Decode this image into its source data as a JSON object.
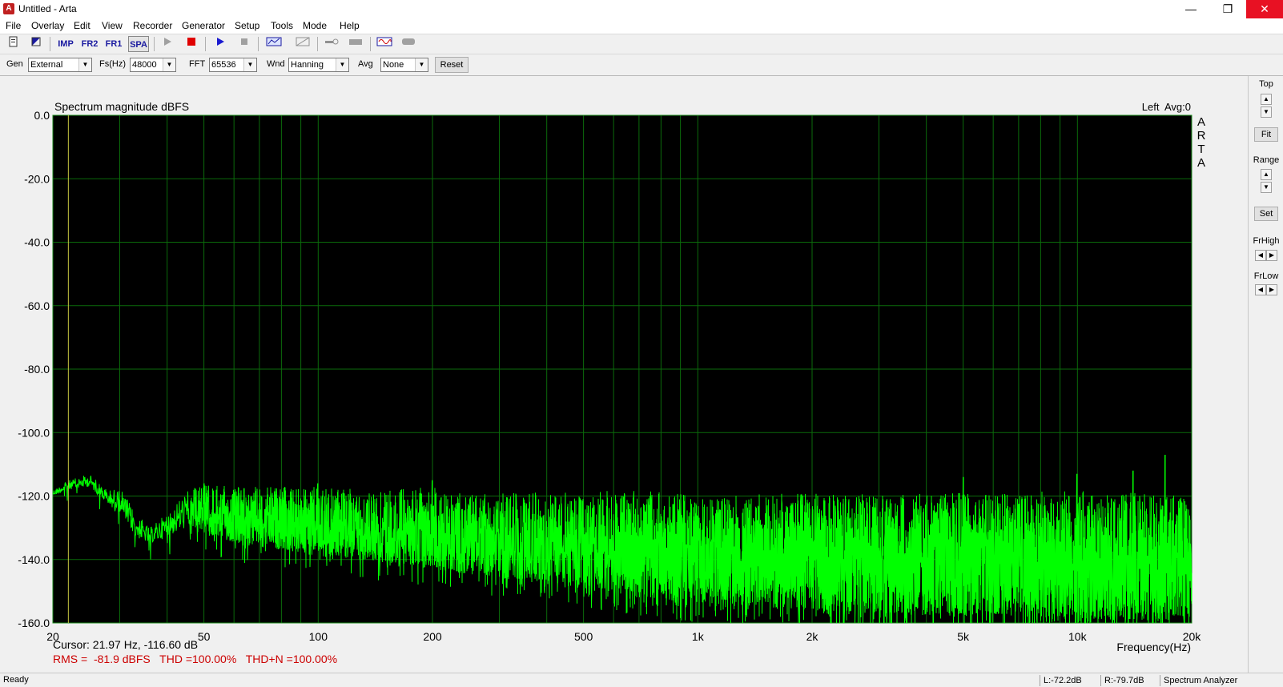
{
  "window": {
    "title": "Untitled - Arta",
    "minimize": "—",
    "maximize": "❐",
    "close": "✕"
  },
  "menu": [
    "File",
    "Overlay",
    "Edit",
    "View",
    "Recorder",
    "Generator",
    "Setup",
    "Tools",
    "Mode",
    "Help"
  ],
  "toolbar": {
    "imp": "IMP",
    "fr2": "FR2",
    "fr1": "FR1",
    "spa": "SPA"
  },
  "controls": {
    "gen_label": "Gen",
    "gen_value": "External",
    "fs_label": "Fs(Hz)",
    "fs_value": "48000",
    "fft_label": "FFT",
    "fft_value": "65536",
    "wnd_label": "Wnd",
    "wnd_value": "Hanning",
    "avg_label": "Avg",
    "avg_value": "None",
    "reset_label": "Reset"
  },
  "chart_data": {
    "type": "line",
    "title": "Spectrum magnitude dBFS",
    "channel_info": "Left  Avg:0",
    "watermark": [
      "A",
      "R",
      "T",
      "A"
    ],
    "xlabel": "Frequency(Hz)",
    "x_scale": "log",
    "xlim": [
      20,
      20000
    ],
    "ylim": [
      -160,
      0
    ],
    "y_ticks": [
      0,
      -20,
      -40,
      -60,
      -80,
      -100,
      -120,
      -140,
      -160
    ],
    "y_tick_labels": [
      "0.0",
      "-20.0",
      "-40.0",
      "-60.0",
      "-80.0",
      "-100.0",
      "-120.0",
      "-140.0",
      "-160.0"
    ],
    "x_tick_labels": [
      {
        "v": 20,
        "t": "20"
      },
      {
        "v": 50,
        "t": "50"
      },
      {
        "v": 100,
        "t": "100"
      },
      {
        "v": 200,
        "t": "200"
      },
      {
        "v": 500,
        "t": "500"
      },
      {
        "v": 1000,
        "t": "1k"
      },
      {
        "v": 2000,
        "t": "2k"
      },
      {
        "v": 5000,
        "t": "5k"
      },
      {
        "v": 10000,
        "t": "10k"
      },
      {
        "v": 20000,
        "t": "20k"
      }
    ],
    "grid": true,
    "cursor_freq": 21.97,
    "series": [
      {
        "color": "#00ff00",
        "noise_floor": {
          "x": [
            20,
            22,
            25,
            28,
            30,
            33,
            36,
            40,
            45,
            50,
            60,
            80,
            100,
            150,
            200,
            300,
            500,
            700,
            1000,
            1500,
            2000,
            3000,
            5000,
            7000,
            10000,
            14000,
            17000,
            20000
          ],
          "upper": [
            -118,
            -115,
            -113,
            -118,
            -117,
            -125,
            -130,
            -125,
            -118,
            -116,
            -117,
            -117,
            -117,
            -118,
            -117,
            -119,
            -118,
            -118,
            -119,
            -119,
            -119,
            -119,
            -119,
            -119,
            -118,
            -119,
            -119,
            -120
          ],
          "lower": [
            -120,
            -118,
            -117,
            -123,
            -125,
            -133,
            -135,
            -133,
            -130,
            -132,
            -135,
            -137,
            -139,
            -141,
            -143,
            -146,
            -149,
            -152,
            -154,
            -155,
            -156,
            -157,
            -158,
            -158,
            -159,
            -159,
            -159,
            -158
          ]
        },
        "peaks": [
          {
            "x": 50,
            "y": -116
          },
          {
            "x": 100,
            "y": -116
          },
          {
            "x": 200,
            "y": -115
          },
          {
            "x": 5000,
            "y": -114
          },
          {
            "x": 10000,
            "y": -113
          },
          {
            "x": 14000,
            "y": -112
          },
          {
            "x": 17000,
            "y": -107
          }
        ]
      }
    ],
    "cursor_text": "Cursor: 21.97 Hz, -116.60 dB",
    "stats_text": "RMS =  -81.9 dBFS   THD =100.00%   THD+N =100.00%"
  },
  "right_panel": {
    "top_label": "Top",
    "fit_label": "Fit",
    "range_label": "Range",
    "set_label": "Set",
    "frhigh_label": "FrHigh",
    "frlow_label": "FrLow"
  },
  "status": {
    "ready": "Ready",
    "left_level": "L:-72.2dB",
    "right_level": "R:-79.7dB",
    "mode": "Spectrum Analyzer"
  },
  "colors": {
    "plot_bg": "#000000",
    "grid": "#0b6b0b",
    "trace": "#00ff00",
    "cursor": "#c8c840",
    "stats_text": "#cc0000"
  }
}
